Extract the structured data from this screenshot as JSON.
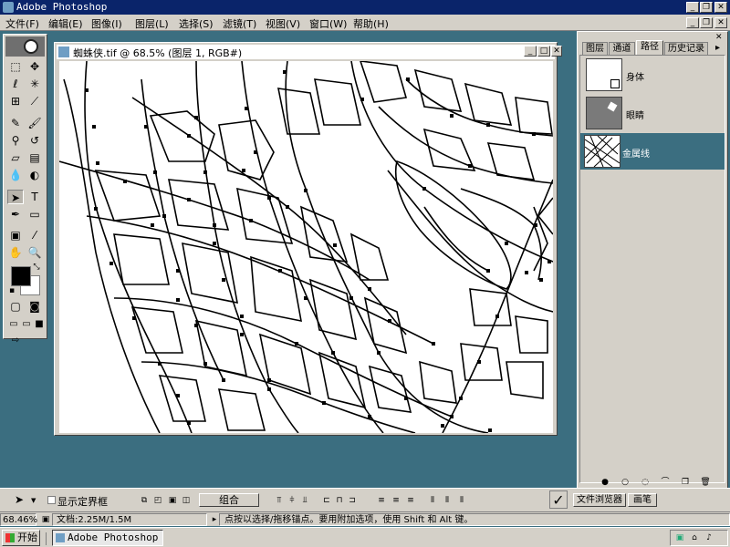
{
  "app": {
    "title": "Adobe Photoshop"
  },
  "menu": [
    "文件(F)",
    "编辑(E)",
    "图像(I)",
    "图层(L)",
    "选择(S)",
    "滤镜(T)",
    "视图(V)",
    "窗口(W)",
    "帮助(H)"
  ],
  "document": {
    "title": "蜘蛛侠.tif @ 68.5% (图层 1, RGB#)"
  },
  "panel": {
    "tabs": [
      "图层",
      "通道",
      "路径",
      "历史记录"
    ],
    "active_tab": "路径",
    "paths": [
      {
        "name": "身体",
        "selected": false
      },
      {
        "name": "眼睛",
        "selected": false
      },
      {
        "name": "金属线",
        "selected": true
      }
    ]
  },
  "options": {
    "show_bounding_box": "显示定界框",
    "combine_button": "组合"
  },
  "bottom_tabs": [
    "文件浏览器",
    "画笔"
  ],
  "status": {
    "zoom": "68.46%",
    "doc_size": "文档:2.25M/1.5M",
    "hint": "点按以选择/拖移锚点。要用附加选项，使用 Shift 和 Alt 键。"
  },
  "taskbar": {
    "start": "开始",
    "app_button": "Adobe Photoshop"
  },
  "colors": {
    "desktop": "#3b6e80",
    "titlebar": "#0a246a",
    "selection": "#3b6e80",
    "face": "#d4d0c8"
  }
}
